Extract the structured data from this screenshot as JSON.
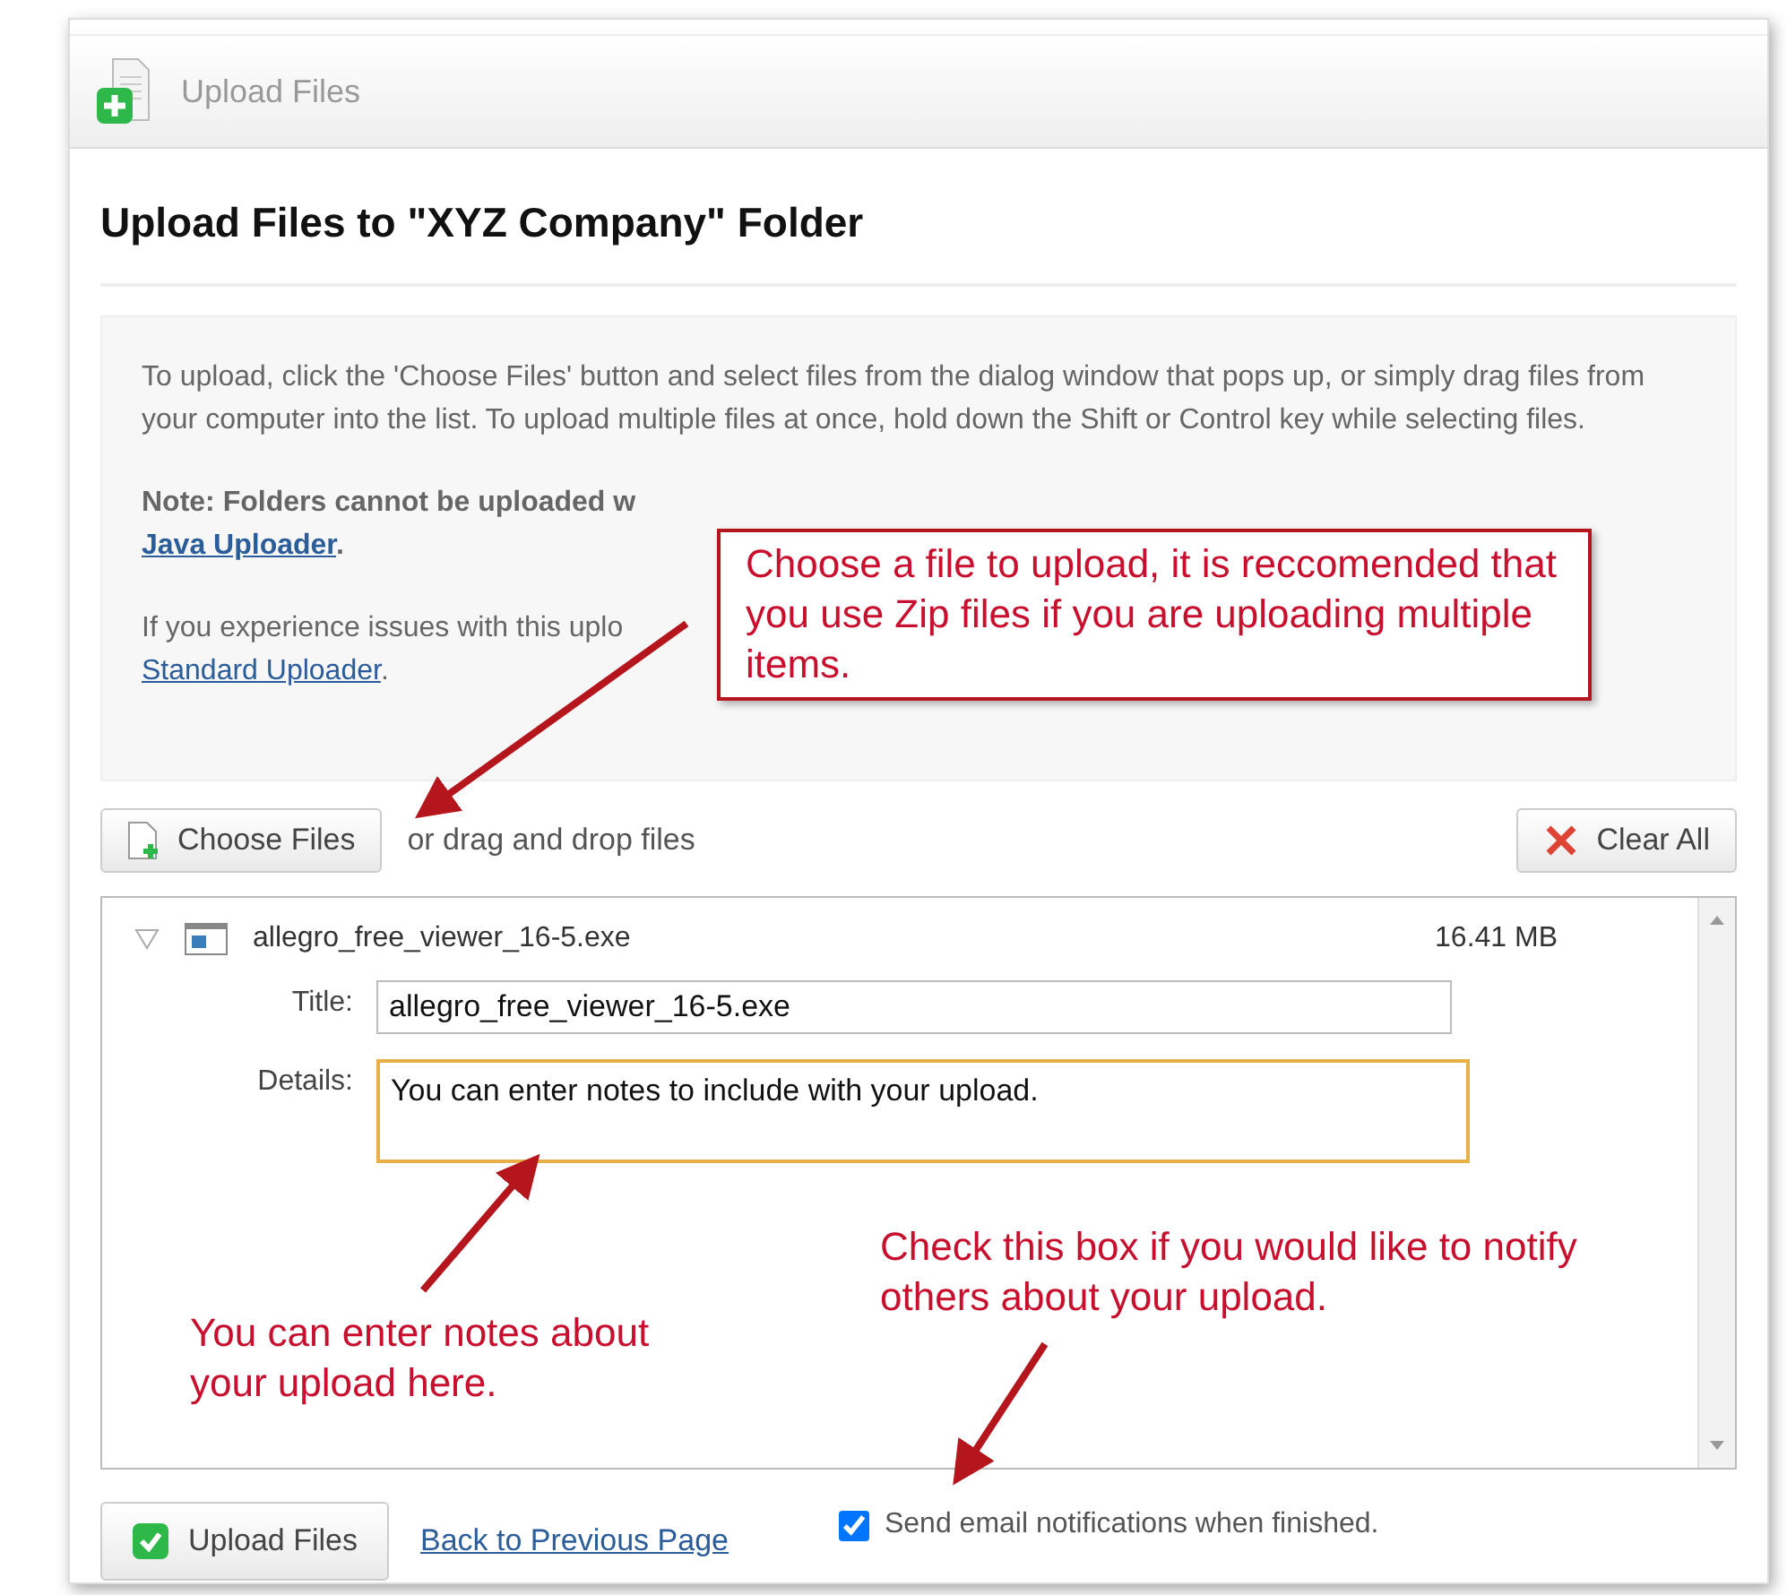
{
  "header": {
    "title": "Upload Files"
  },
  "heading": "Upload Files to \"XYZ Company\" Folder",
  "instructions": {
    "paragraph": "To upload, click the 'Choose Files' button and select files from the dialog window that pops up, or simply drag files from your computer into the list. To upload multiple files at once, hold down the Shift or Control key while selecting files.",
    "note": {
      "text": "Note: Folders cannot be uploaded w",
      "link": "Java Uploader",
      "after": "."
    },
    "issue": {
      "text": "If you experience issues with this uplo",
      "link": "Standard Uploader",
      "after": "."
    }
  },
  "choose_button": "Choose Files",
  "drop_hint": "or drag and drop files",
  "clear_button": "Clear All",
  "files": [
    {
      "name": "allegro_free_viewer_16-5.exe",
      "size": "16.41 MB",
      "expanded": true,
      "title_label": "Title:",
      "title_value": "allegro_free_viewer_16-5.exe",
      "details_label": "Details:",
      "details_value": "You can enter notes to include with your upload."
    }
  ],
  "upload_button": "Upload Files",
  "back_link": "Back to Previous Page",
  "notify": {
    "label": "Send email notifications when finished.",
    "checked": true
  },
  "annotations": [
    {
      "kind": "boxed",
      "text": "Choose a file to upload, it is reccomended that you use Zip files if you are uploading multiple items."
    },
    {
      "kind": "plain",
      "text": "You can enter notes about your upload here."
    },
    {
      "kind": "plain",
      "text": "Check this box if you would like to notify others about your upload."
    }
  ]
}
